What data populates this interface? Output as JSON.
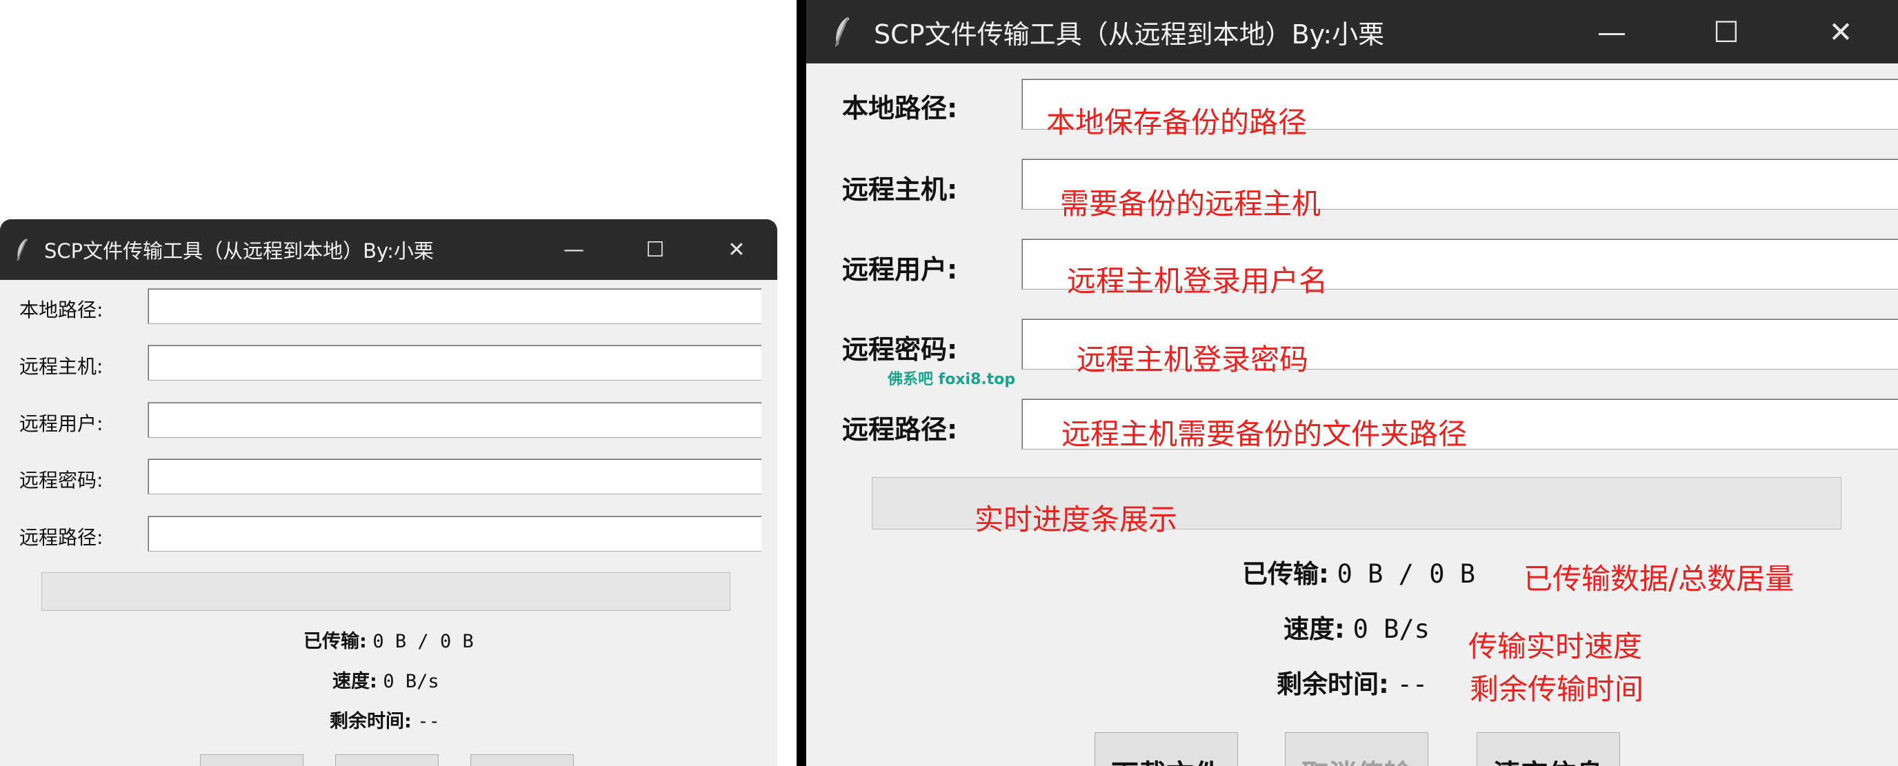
{
  "window": {
    "title": "SCP文件传输工具（从远程到本地）By:小栗",
    "controls": {
      "minimize": "—",
      "maximize": "☐",
      "close": "✕"
    }
  },
  "fields": [
    {
      "label": "本地路径:",
      "value": "",
      "annotation": "本地保存备份的路径"
    },
    {
      "label": "远程主机:",
      "value": "",
      "annotation": "需要备份的远程主机"
    },
    {
      "label": "远程用户:",
      "value": "",
      "annotation": "远程主机登录用户名"
    },
    {
      "label": "远程密码:",
      "value": "",
      "annotation": "远程主机登录密码"
    },
    {
      "label": "远程路径:",
      "value": "",
      "annotation": "远程主机需要备份的文件夹路径"
    }
  ],
  "progress": {
    "value": 0,
    "annotation": "实时进度条展示"
  },
  "stats": {
    "transferred": {
      "label": "已传输:",
      "value": "0 B / 0 B",
      "annotation": "已传输数据/总数居量"
    },
    "speed": {
      "label": "速度:",
      "value": "0 B/s",
      "annotation": "传输实时速度"
    },
    "remaining": {
      "label": "剩余时间:",
      "value": "--",
      "annotation": "剩余传输时间"
    }
  },
  "buttons": {
    "download": {
      "label": "下载文件",
      "enabled": true
    },
    "cancel": {
      "label": "取消传输",
      "enabled": false
    },
    "clear": {
      "label": "清空信息",
      "enabled": true
    }
  },
  "watermark": "佛系吧  foxi8.top",
  "icons": {
    "app": "feather-icon"
  },
  "colors": {
    "titlebar": "#2b2b2b",
    "window_bg": "#f0f0f0",
    "annotation": "#e8221f",
    "watermark": "#1aa38f"
  }
}
